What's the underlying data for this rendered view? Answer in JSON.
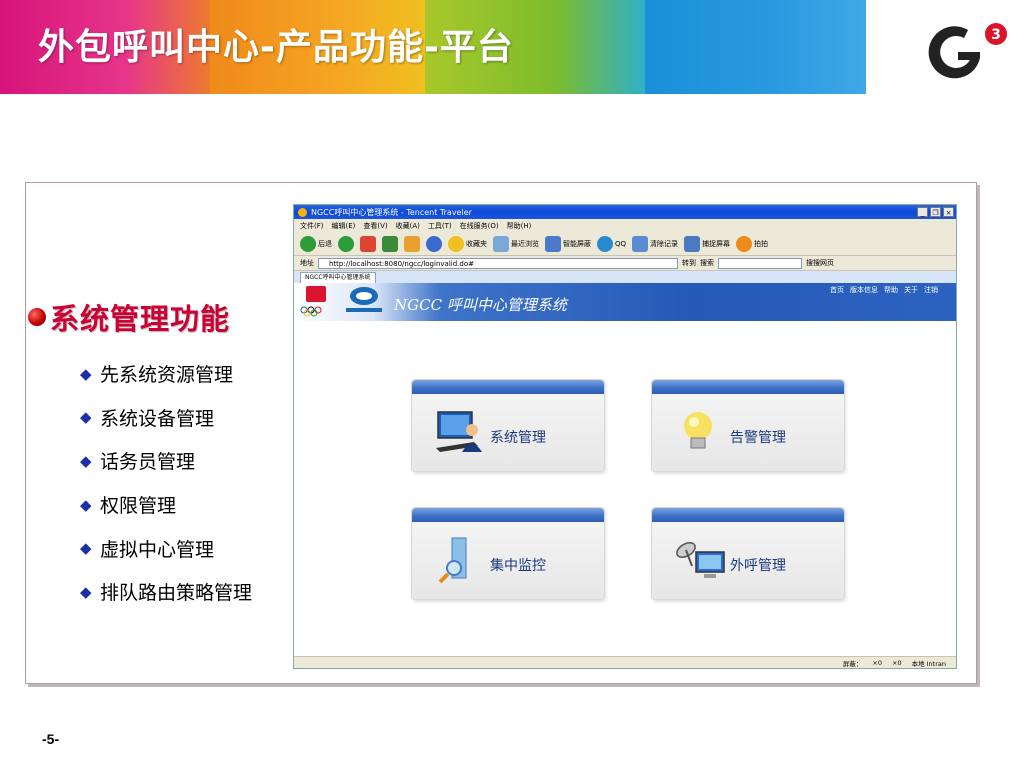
{
  "slide": {
    "title": "外包呼叫中心-产品功能-平台",
    "page_number": "-5-",
    "logo": "g3-logo"
  },
  "section": {
    "heading": "系统管理功能",
    "items": [
      {
        "label": "先系统资源管理"
      },
      {
        "label": "系统设备管理"
      },
      {
        "label": "话务员管理"
      },
      {
        "label": "权限管理"
      },
      {
        "label": "虚拟中心管理"
      },
      {
        "label": "排队路由策略管理"
      }
    ]
  },
  "browser": {
    "window_title": "NGCC呼叫中心管理系统 - Tencent Traveler",
    "menu": [
      "文件(F)",
      "编辑(E)",
      "查看(V)",
      "收藏(A)",
      "工具(T)",
      "在线服务(O)",
      "帮助(H)"
    ],
    "toolbar": {
      "back": "后退",
      "favorites": "收藏夹",
      "recent": "最近浏览",
      "smart_screen": "智能屏蔽",
      "qq": "QQ",
      "clear_history": "清除记录",
      "capture": "捕捉屏幕",
      "snapshot": "拍拍"
    },
    "address_label": "地址",
    "address_value": "http://localhost:8080/ngcc/loginvalid.do#",
    "go_label": "转到",
    "search_label": "搜索",
    "search_web": "搜搜网页",
    "tab_label": "NGCC呼叫中心管理系统",
    "status": {
      "blocked": "屏蔽：",
      "count1": "×0",
      "count2": "×0",
      "zone": "本地 Intran"
    }
  },
  "app": {
    "title": "NGCC 呼叫中心管理系统",
    "nav": [
      "首页",
      "版本信息",
      "帮助",
      "关于",
      "注销"
    ],
    "tiles": [
      {
        "label": "系统管理",
        "icon": "user-monitor-icon"
      },
      {
        "label": "告警管理",
        "icon": "lightbulb-icon"
      },
      {
        "label": "集中监控",
        "icon": "monitor-search-icon"
      },
      {
        "label": "外呼管理",
        "icon": "satellite-computer-icon"
      }
    ]
  },
  "colors": {
    "heading": "#cc0033",
    "diamond": "#1a2fa8",
    "app_header": "#2559b8"
  }
}
